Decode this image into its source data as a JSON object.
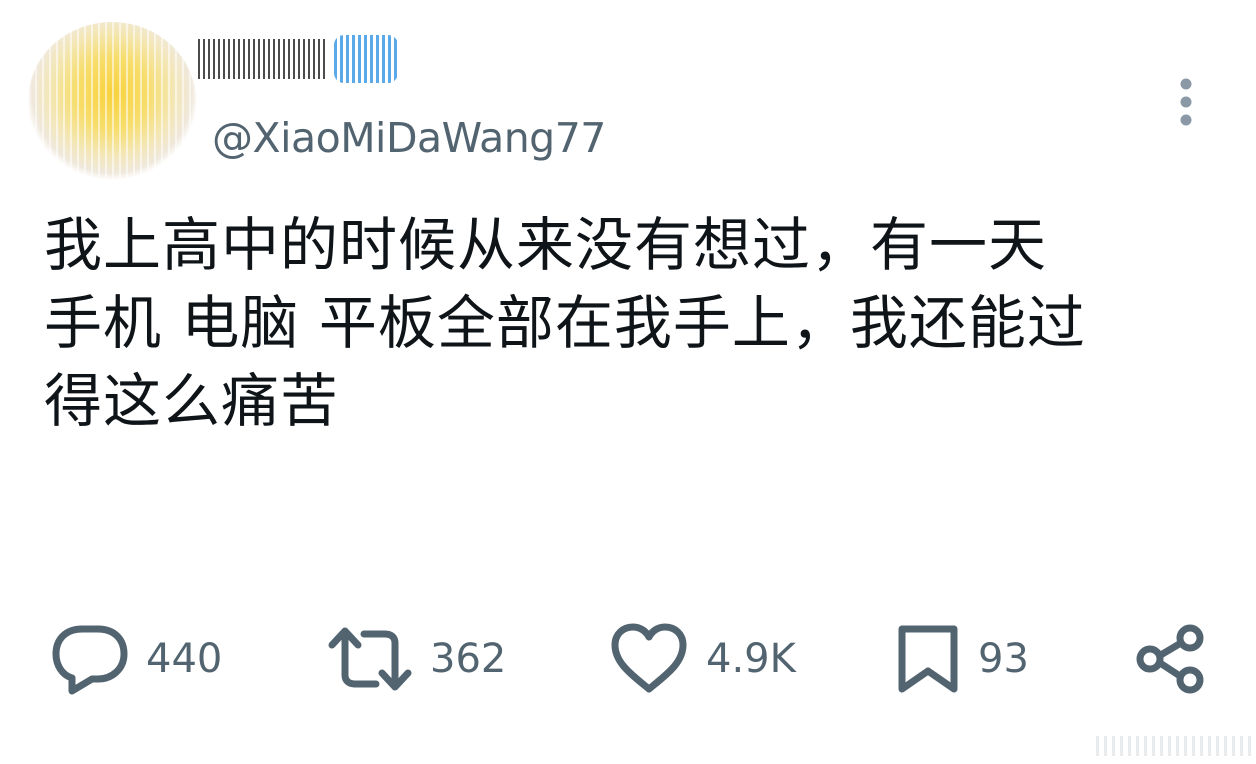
{
  "author": {
    "handle": "@XiaoMiDaWang77"
  },
  "tweet": {
    "lines": [
      "我上高中的时候从来没有想过，有一天",
      "手机 电脑 平板全部在我手上，我还能过",
      "得这么痛苦"
    ]
  },
  "actions": {
    "reply": {
      "icon": "reply-icon",
      "count": "440"
    },
    "retweet": {
      "icon": "retweet-icon",
      "count": "362"
    },
    "like": {
      "icon": "heart-icon",
      "count": "4.9K"
    },
    "bookmark": {
      "icon": "bookmark-icon",
      "count": "93"
    },
    "share": {
      "icon": "share-icon"
    }
  },
  "colors": {
    "text": "#0f1419",
    "secondary": "#536471",
    "verified": "#3d9be6"
  }
}
